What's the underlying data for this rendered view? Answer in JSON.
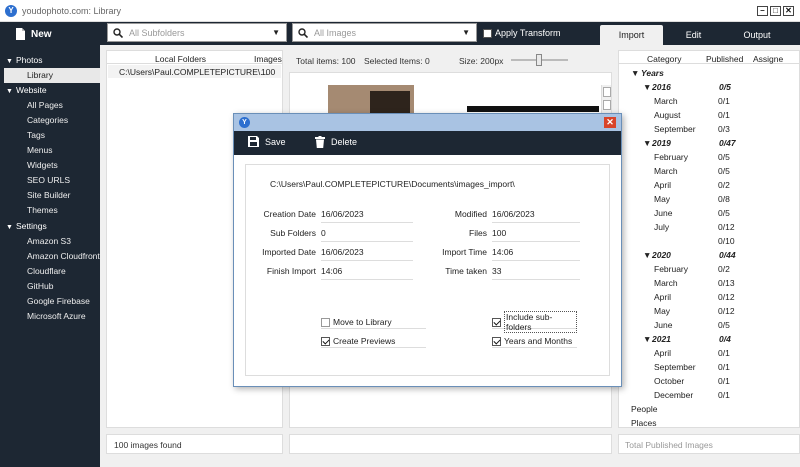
{
  "window": {
    "title": "youdophoto.com: Library"
  },
  "toolbar": {
    "new_label": "New",
    "subfolders_placeholder": "All Subfolders",
    "images_placeholder": "All Images",
    "apply_transform_label": "Apply Transform",
    "apply_transform_checked": false,
    "tabs": [
      {
        "label": "Import",
        "active": true
      },
      {
        "label": "Edit",
        "active": false
      },
      {
        "label": "Output",
        "active": false
      }
    ]
  },
  "sidebar": {
    "sections": [
      {
        "label": "Photos",
        "items": [
          "Library"
        ]
      },
      {
        "label": "Website",
        "items": [
          "All Pages",
          "Categories",
          "Tags",
          "Menus",
          "Widgets",
          "SEO URLS",
          "Site Builder",
          "Themes"
        ]
      },
      {
        "label": "Settings",
        "items": [
          "Amazon S3",
          "Amazon Cloudfront",
          "Cloudflare",
          "GitHub",
          "Google Firebase",
          "Microsoft Azure"
        ]
      }
    ],
    "selected": "Library"
  },
  "folders": {
    "headers": [
      "Local Folders",
      "Images"
    ],
    "rows": [
      {
        "path": "C:\\Users\\Paul.COMPLETEPICTURE\\...",
        "images": "100"
      }
    ],
    "status": "100 images found"
  },
  "gallery": {
    "total_items": "Total items: 100",
    "selected_items": "Selected Items: 0",
    "size": "Size: 200px"
  },
  "dialog": {
    "save_label": "Save",
    "delete_label": "Delete",
    "close_glyph": "✕",
    "path": "C:\\Users\\Paul.COMPLETEPICTURE\\Documents\\images_import\\",
    "fields": {
      "creation_date": {
        "label": "Creation Date",
        "value": "16/06/2023"
      },
      "sub_folders": {
        "label": "Sub Folders",
        "value": "0"
      },
      "imported_date": {
        "label": "Imported Date",
        "value": "16/06/2023"
      },
      "finish_import": {
        "label": "Finish Import",
        "value": "14:06"
      },
      "modified": {
        "label": "Modified",
        "value": "16/06/2023"
      },
      "files": {
        "label": "Files",
        "value": "100"
      },
      "import_time": {
        "label": "Import Time",
        "value": "14:06"
      },
      "time_taken": {
        "label": "Time taken",
        "value": "33"
      }
    },
    "options": {
      "move_to_library": {
        "label": "Move to Library",
        "checked": false
      },
      "create_previews": {
        "label": "Create Previews",
        "checked": true
      },
      "include_subfolders": {
        "label": "Include sub-folders",
        "checked": true
      },
      "years_and_months": {
        "label": "Years and Months",
        "checked": true
      }
    }
  },
  "categories": {
    "headers": [
      "Category",
      "Published",
      "Assigne"
    ],
    "years_label": "Years",
    "years": [
      {
        "year": "2016",
        "published": "0/5",
        "months": [
          [
            "March",
            "0/1"
          ],
          [
            "August",
            "0/1"
          ],
          [
            "September",
            "0/3"
          ]
        ]
      },
      {
        "year": "2019",
        "published": "0/47",
        "months": [
          [
            "February",
            "0/5"
          ],
          [
            "March",
            "0/5"
          ],
          [
            "April",
            "0/2"
          ],
          [
            "May",
            "0/8"
          ],
          [
            "June",
            "0/5"
          ],
          [
            "July",
            "0/12"
          ],
          [
            "",
            "0/10"
          ]
        ]
      },
      {
        "year": "2020",
        "published": "0/44",
        "months": [
          [
            "February",
            "0/2"
          ],
          [
            "March",
            "0/13"
          ],
          [
            "April",
            "0/12"
          ],
          [
            "May",
            "0/12"
          ],
          [
            "June",
            "0/5"
          ]
        ]
      },
      {
        "year": "2021",
        "published": "0/4",
        "months": [
          [
            "April",
            "0/1"
          ],
          [
            "September",
            "0/1"
          ],
          [
            "October",
            "0/1"
          ],
          [
            "December",
            "0/1"
          ]
        ]
      }
    ],
    "extra": [
      "People",
      "Places"
    ],
    "status": "Total Published Images"
  }
}
